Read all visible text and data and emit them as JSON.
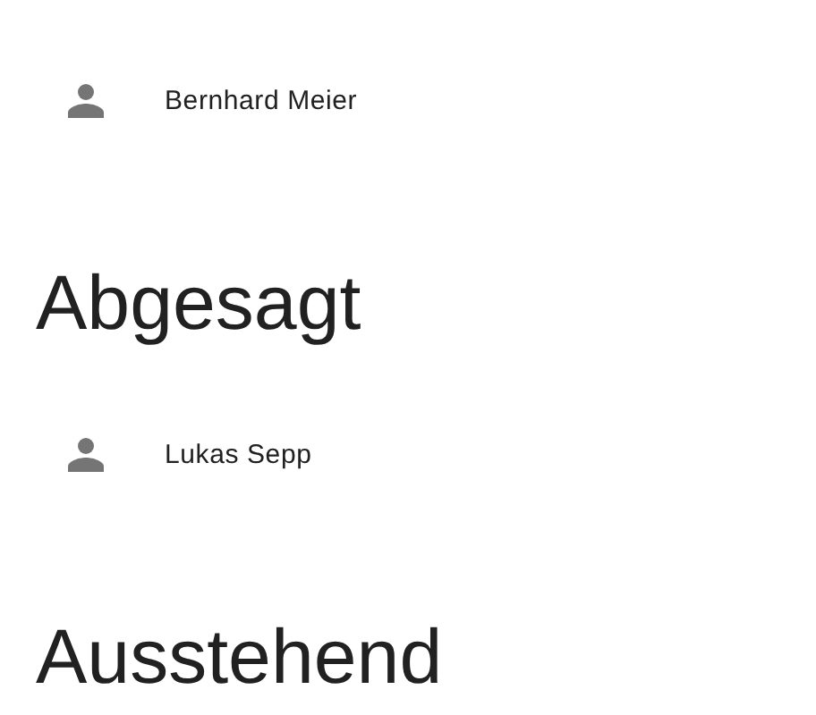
{
  "sections": [
    {
      "people": [
        {
          "name": "Bernhard Meier"
        }
      ]
    },
    {
      "title": "Abgesagt",
      "people": [
        {
          "name": "Lukas Sepp"
        }
      ]
    },
    {
      "title": "Ausstehend"
    }
  ]
}
